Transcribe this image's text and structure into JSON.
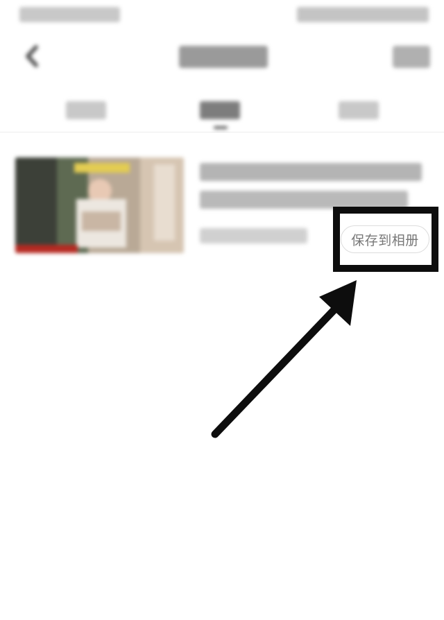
{
  "status_bar": {
    "time": "",
    "indicators": ""
  },
  "nav": {
    "back_icon": "back-chevron-icon",
    "title": "",
    "action": ""
  },
  "tabs": [
    {
      "label": ""
    },
    {
      "label": "",
      "active": true
    },
    {
      "label": ""
    }
  ],
  "item": {
    "thumbnail_icon": "video-thumbnail",
    "title": "",
    "meta": "",
    "save_button_label": "保存到相册"
  },
  "annotation": {
    "highlight_color": "#0d0d0d",
    "arrow_target": "save-button"
  },
  "colors": {
    "background": "#ffffff",
    "button_text": "#777777",
    "annotation": "#0d0d0d"
  }
}
